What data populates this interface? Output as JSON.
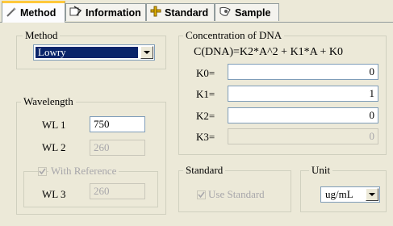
{
  "tabs": [
    {
      "label": "Method",
      "icon": "method-icon"
    },
    {
      "label": "Information",
      "icon": "information-icon"
    },
    {
      "label": "Standard",
      "icon": "standard-icon"
    },
    {
      "label": "Sample",
      "icon": "sample-icon"
    }
  ],
  "method_group": {
    "title": "Method",
    "selected": "Lowry"
  },
  "concentration_group": {
    "title": "Concentration of DNA",
    "formula": "C(DNA)=K2*A^2 + K1*A + K0",
    "k0_label": "K0=",
    "k0_value": "0",
    "k1_label": "K1=",
    "k1_value": "1",
    "k2_label": "K2=",
    "k2_value": "0",
    "k3_label": "K3=",
    "k3_value": "0"
  },
  "wavelength_group": {
    "title": "Wavelength",
    "wl1_label": "WL 1",
    "wl1_value": "750",
    "wl2_label": "WL 2",
    "wl2_value": "260",
    "reference_label": "With Reference",
    "wl3_label": "WL 3",
    "wl3_value": "260"
  },
  "standard_group": {
    "title": "Standard",
    "use_standard_label": "Use Standard"
  },
  "unit_group": {
    "title": "Unit",
    "selected": "ug/mL"
  }
}
